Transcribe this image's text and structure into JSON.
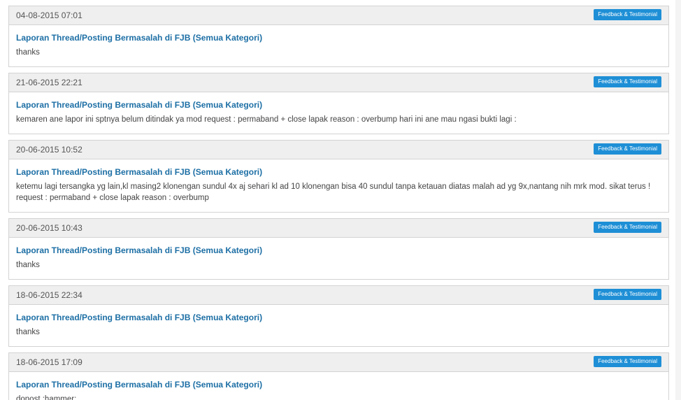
{
  "posts": [
    {
      "date": "04-08-2015 07:01",
      "tag": "Feedback & Testimonial",
      "title": "Laporan Thread/Posting Bermasalah di FJB (Semua Kategori)",
      "text": "thanks"
    },
    {
      "date": "21-06-2015 22:21",
      "tag": "Feedback & Testimonial",
      "title": "Laporan Thread/Posting Bermasalah di FJB (Semua Kategori)",
      "text": "kemaren ane lapor ini sptnya belum ditindak ya mod request : permaband + close lapak reason : overbump hari ini ane mau ngasi bukti lagi :"
    },
    {
      "date": "20-06-2015 10:52",
      "tag": "Feedback & Testimonial",
      "title": "Laporan Thread/Posting Bermasalah di FJB (Semua Kategori)",
      "text": "ketemu lagi tersangka yg lain,kl masing2 klonengan sundul 4x aj sehari kl ad 10 klonengan bisa 40 sundul tanpa ketauan diatas malah ad yg 9x,nantang nih mrk mod. sikat terus ! request : permaband + close lapak reason : overbump"
    },
    {
      "date": "20-06-2015 10:43",
      "tag": "Feedback & Testimonial",
      "title": "Laporan Thread/Posting Bermasalah di FJB (Semua Kategori)",
      "text": "thanks"
    },
    {
      "date": "18-06-2015 22:34",
      "tag": "Feedback & Testimonial",
      "title": "Laporan Thread/Posting Bermasalah di FJB (Semua Kategori)",
      "text": "thanks"
    },
    {
      "date": "18-06-2015 17:09",
      "tag": "Feedback & Testimonial",
      "title": "Laporan Thread/Posting Bermasalah di FJB (Semua Kategori)",
      "text": "donost :hammer:"
    }
  ]
}
